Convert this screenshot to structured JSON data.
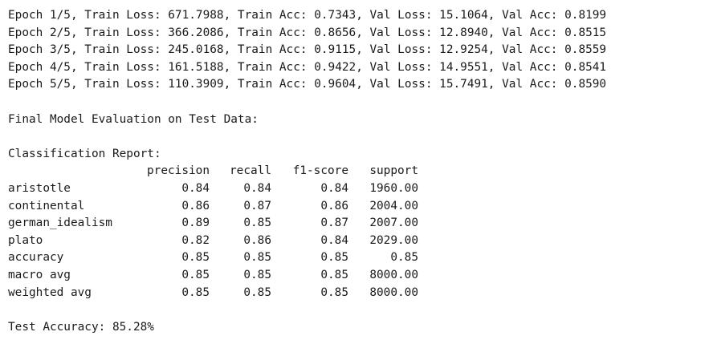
{
  "epochs": [
    "Epoch 1/5, Train Loss: 671.7988, Train Acc: 0.7343, Val Loss: 15.1064, Val Acc: 0.8199",
    "Epoch 2/5, Train Loss: 366.2086, Train Acc: 0.8656, Val Loss: 12.8940, Val Acc: 0.8515",
    "Epoch 3/5, Train Loss: 245.0168, Train Acc: 0.9115, Val Loss: 12.9254, Val Acc: 0.8559",
    "Epoch 4/5, Train Loss: 161.5188, Train Acc: 0.9422, Val Loss: 14.9551, Val Acc: 0.8541",
    "Epoch 5/5, Train Loss: 110.3909, Train Acc: 0.9604, Val Loss: 15.7491, Val Acc: 0.8590"
  ],
  "final_eval_heading": "Final Model Evaluation on Test Data:",
  "report": {
    "heading": "Classification Report:",
    "columns": [
      "precision",
      "recall",
      "f1-score",
      "support"
    ],
    "rows": [
      {
        "label": "aristotle",
        "precision": "0.84",
        "recall": "0.84",
        "f1": "0.84",
        "support": "1960.00"
      },
      {
        "label": "continental",
        "precision": "0.86",
        "recall": "0.87",
        "f1": "0.86",
        "support": "2004.00"
      },
      {
        "label": "german_idealism",
        "precision": "0.89",
        "recall": "0.85",
        "f1": "0.87",
        "support": "2007.00"
      },
      {
        "label": "plato",
        "precision": "0.82",
        "recall": "0.86",
        "f1": "0.84",
        "support": "2029.00"
      },
      {
        "label": "accuracy",
        "precision": "0.85",
        "recall": "0.85",
        "f1": "0.85",
        "support": "0.85"
      },
      {
        "label": "macro avg",
        "precision": "0.85",
        "recall": "0.85",
        "f1": "0.85",
        "support": "8000.00"
      },
      {
        "label": "weighted avg",
        "precision": "0.85",
        "recall": "0.85",
        "f1": "0.85",
        "support": "8000.00"
      }
    ]
  },
  "test_accuracy": "Test Accuracy: 85.28%"
}
